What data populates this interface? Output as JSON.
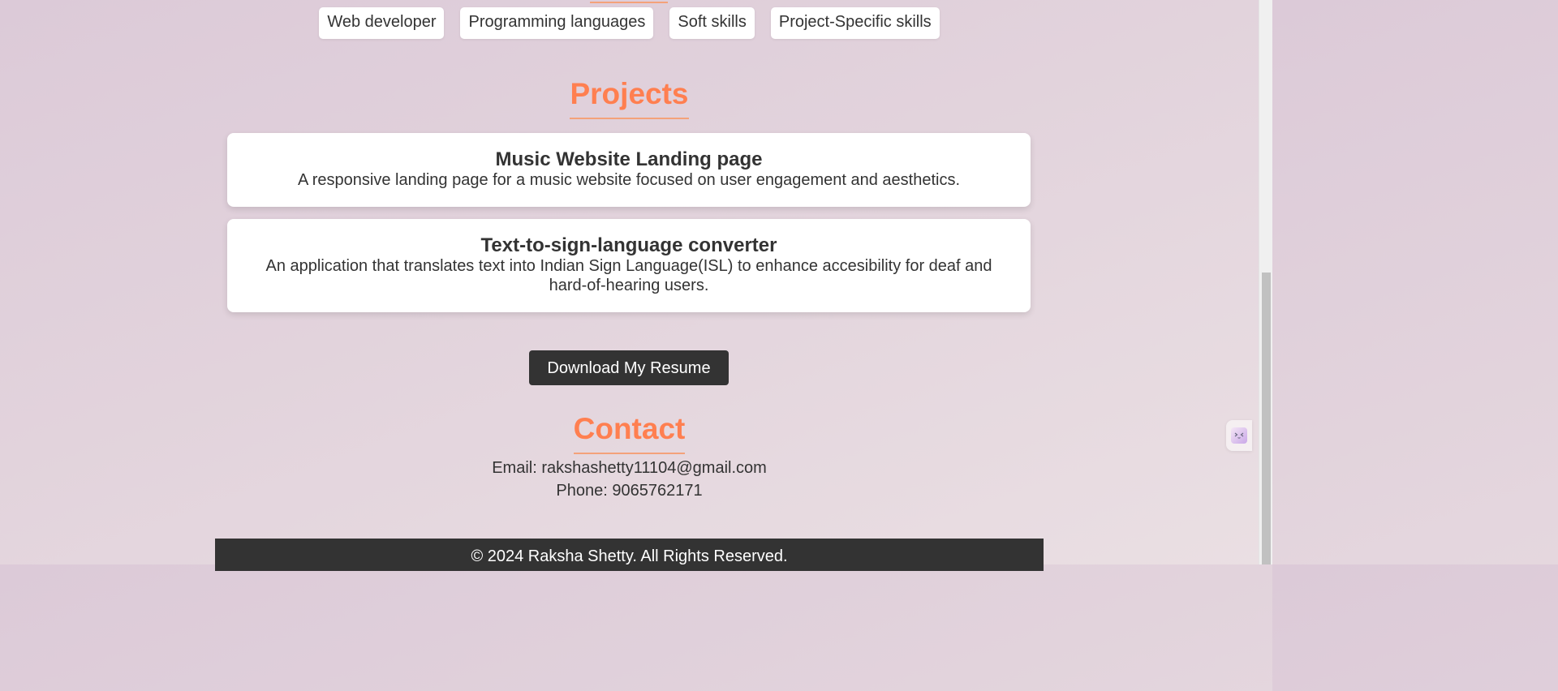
{
  "skills": {
    "chips": [
      {
        "label": "Web developer"
      },
      {
        "label": "Programming languages"
      },
      {
        "label": "Soft skills"
      },
      {
        "label": "Project-Specific skills"
      }
    ]
  },
  "projects": {
    "heading": "Projects",
    "items": [
      {
        "title": "Music Website Landing page",
        "description": "A responsive landing page for a music website focused on user engagement and aesthetics."
      },
      {
        "title": "Text-to-sign-language converter",
        "description": "An application that translates text into Indian Sign Language(ISL) to enhance accesibility for deaf and hard-of-hearing users."
      }
    ]
  },
  "download": {
    "label": "Download My Resume"
  },
  "contact": {
    "heading": "Contact",
    "email": "Email: rakshashetty11104@gmail.com",
    "phone": "Phone: 9065762171"
  },
  "footer": {
    "text": "© 2024 Raksha Shetty. All Rights Reserved."
  },
  "colors": {
    "accent": "#ff7f50",
    "dark": "#333333",
    "card": "#ffffff"
  },
  "icons": {
    "side_widget": "assistant-face-icon"
  }
}
